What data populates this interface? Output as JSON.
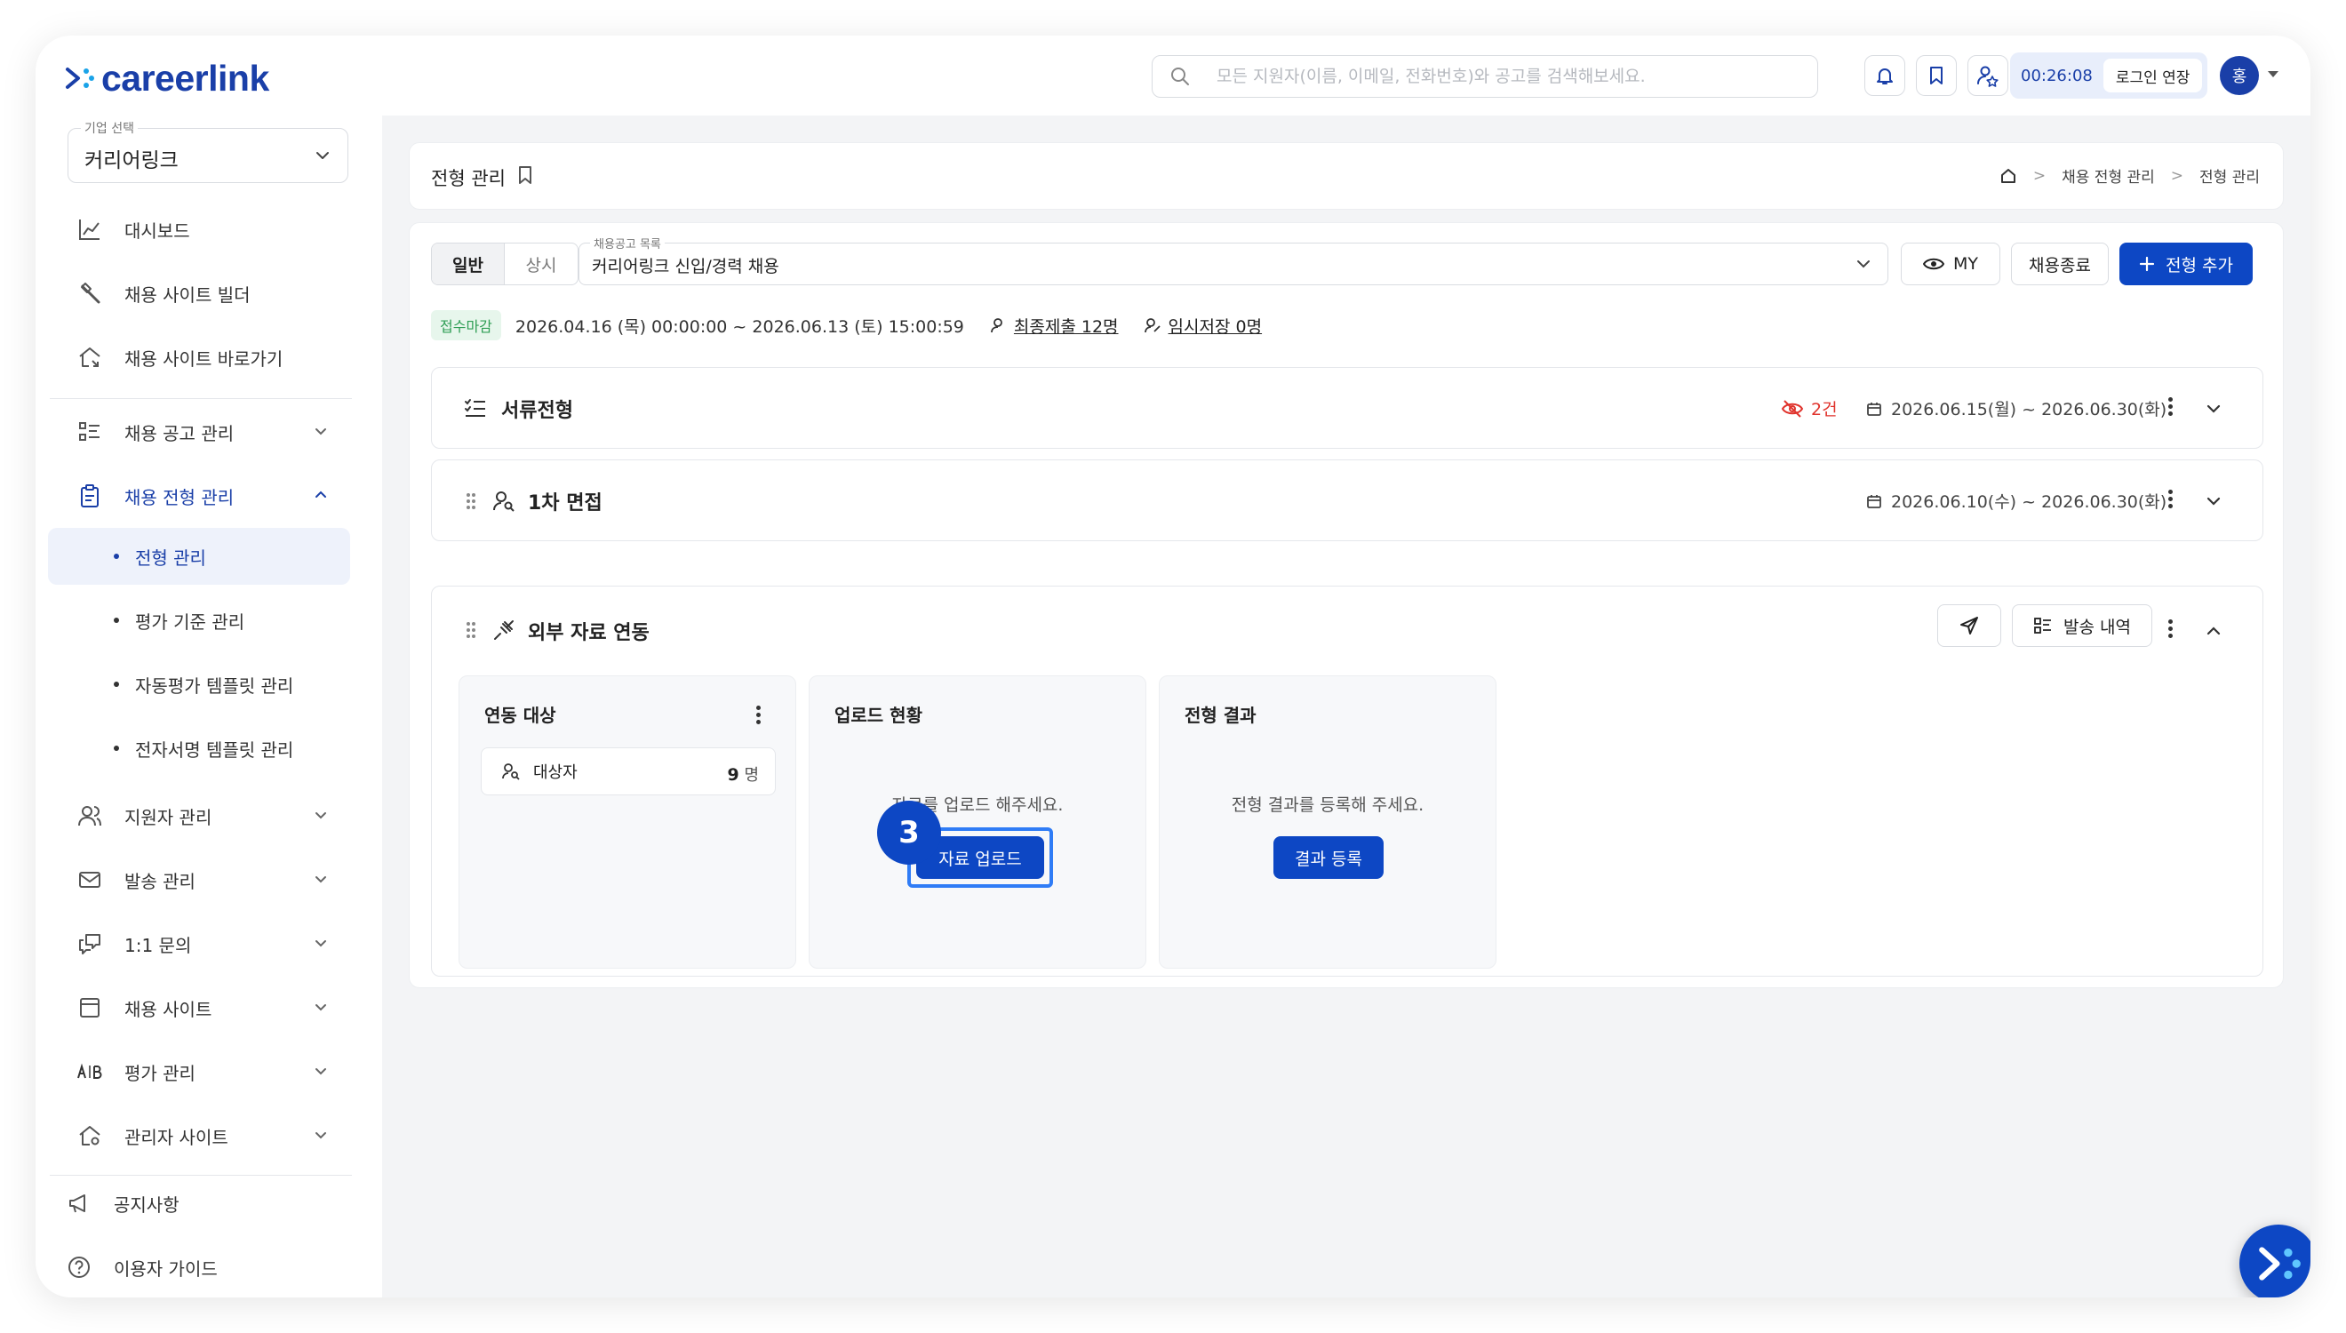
{
  "brand": {
    "name": "careerlink",
    "color": "#1a3fa8",
    "primary": "#0d47c4"
  },
  "header": {
    "search_placeholder": "모든 지원자(이름, 이메일, 전화번호)와 공고를 검색해보세요.",
    "timer": "00:26:08",
    "extend_label": "로그인 연장",
    "avatar_initial": "홍",
    "icons": [
      "bell-icon",
      "bookmark-icon",
      "user-star-icon"
    ]
  },
  "sidebar": {
    "company_label": "기업 선택",
    "company_value": "커리어링크",
    "items": [
      {
        "label": "대시보드",
        "icon": "chart-icon"
      },
      {
        "label": "채용 사이트 빌더",
        "icon": "tools-icon"
      },
      {
        "label": "채용 사이트 바로가기",
        "icon": "home-link-icon"
      },
      {
        "label": "채용 공고 관리",
        "icon": "list-icon"
      },
      {
        "label": "채용 전형 관리",
        "icon": "clipboard-icon"
      },
      {
        "label": "지원자 관리",
        "icon": "users-icon"
      },
      {
        "label": "발송 관리",
        "icon": "mail-icon"
      },
      {
        "label": "1:1 문의",
        "icon": "chat-icon"
      },
      {
        "label": "채용 사이트",
        "icon": "browser-icon"
      },
      {
        "label": "평가 관리",
        "icon": "ab-icon"
      },
      {
        "label": "관리자 사이트",
        "icon": "admin-home-icon"
      }
    ],
    "sub_items": [
      "전형 관리",
      "평가 기준 관리",
      "자동평가 템플릿 관리",
      "전자서명 템플릿 관리"
    ],
    "footer": [
      {
        "label": "공지사항",
        "icon": "megaphone-icon"
      },
      {
        "label": "이용자 가이드",
        "icon": "help-icon"
      }
    ]
  },
  "page": {
    "title": "전형 관리",
    "breadcrumb": [
      "채용 전형 관리",
      "전형 관리"
    ]
  },
  "toolbar": {
    "tabs": [
      "일반",
      "상시"
    ],
    "job_label": "채용공고 목록",
    "job_value": "커리어링크 신입/경력 채용",
    "my_label": "MY",
    "close_label": "채용종료",
    "add_label": "전형 추가"
  },
  "info": {
    "status": "접수마감",
    "period": "2026.04.16 (목) 00:00:00 ~ 2026.06.13 (토) 15:00:59",
    "final_submit": "최종제출 12명",
    "temp_save": "임시저장 0명"
  },
  "stages": [
    {
      "title": "서류전형",
      "hidden_count": "2건",
      "date": "2026.06.15(월) ~ 2026.06.30(화)"
    },
    {
      "title": "1차 면접",
      "date": "2026.06.10(수) ~ 2026.06.30(화)"
    },
    {
      "title": "외부 자료 연동",
      "history_label": "발송 내역"
    }
  ],
  "panels": {
    "target": {
      "title": "연동 대상",
      "row_label": "대상자",
      "count": "9",
      "unit": "명"
    },
    "upload": {
      "title": "업로드 현황",
      "message": "자료를 업로드 해주세요.",
      "button": "자료 업로드"
    },
    "result": {
      "title": "전형 결과",
      "message": "전형 결과를 등록해 주세요.",
      "button": "결과 등록"
    }
  },
  "step": "3"
}
